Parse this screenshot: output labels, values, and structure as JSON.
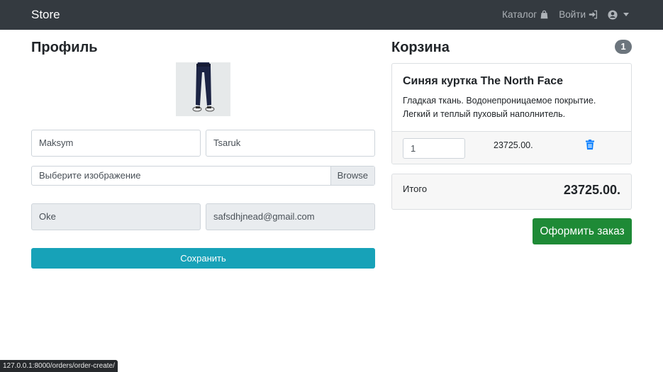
{
  "navbar": {
    "brand": "Store",
    "catalog_label": "Каталог",
    "login_label": "Войти"
  },
  "profile": {
    "title": "Профиль",
    "first_name": "Maksym",
    "last_name": "Tsaruk",
    "file_placeholder": "Выберите изображение",
    "browse_label": "Browse",
    "username": "Oke",
    "email": "safsdhjnead@gmail.com",
    "save_label": "Сохранить"
  },
  "cart": {
    "title": "Корзина",
    "count": "1",
    "item": {
      "name": "Синяя куртка The North Face",
      "description": "Гладкая ткань. Водонепроницаемое покрытие. Легкий и теплый пуховый наполнитель.",
      "quantity": "1",
      "price": "23725.00."
    },
    "total_label": "Итого",
    "total_value": "23725.00.",
    "order_label": "Оформить заказ"
  },
  "status_bar": {
    "url": "127.0.0.1:8000/orders/order-create/"
  },
  "colors": {
    "navbar": "#343a40",
    "save_button": "#17a2b8",
    "order_button": "#1e8a36",
    "trash_icon": "#007bff",
    "badge": "#6c757d"
  },
  "icons": [
    "shopping-bag-icon",
    "sign-in-icon",
    "user-circle-icon",
    "chevron-down-icon",
    "trash-icon"
  ]
}
